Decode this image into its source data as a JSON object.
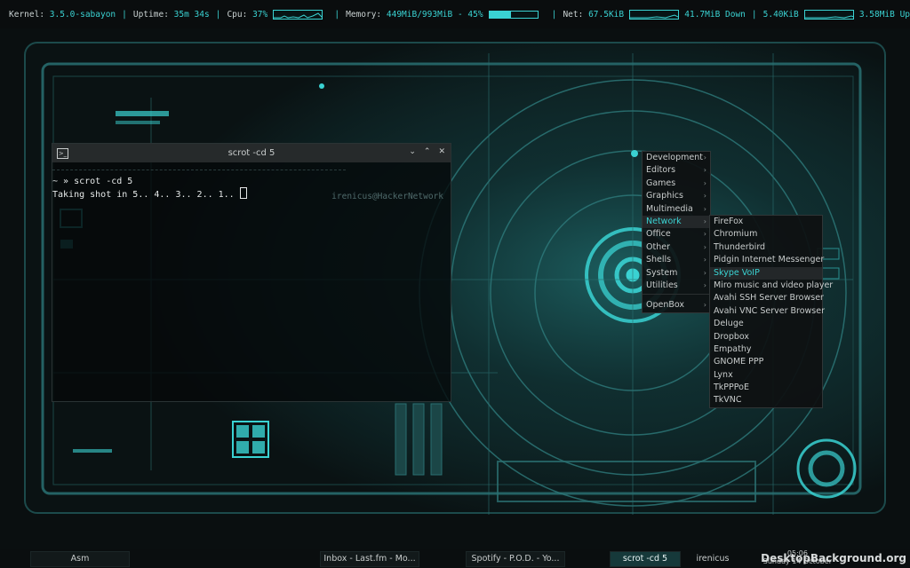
{
  "conky": {
    "kernel_label": "Kernel:",
    "kernel_value": "3.5.0-sabayon",
    "uptime_label": "Uptime:",
    "uptime_value": "35m 34s",
    "cpu_label": "Cpu:",
    "cpu_value": "37%",
    "memory_label": "Memory:",
    "memory_value": "449MiB/993MiB - 45%",
    "memory_fraction": 0.45,
    "net_label": "Net:",
    "net_down_rate": "67.5KiB",
    "net_down_total": "41.7MiB Down",
    "net_up_rate": "5.40KiB",
    "net_up_total": "3.58MiB Up",
    "accent_color": "#3ad2d2"
  },
  "terminal": {
    "title": "scrot -cd 5",
    "title_icon": "terminal-icon",
    "buttons": [
      "chevron-down-icon",
      "chevron-up-icon",
      "close-icon"
    ],
    "prompt": "~ » scrot -cd 5",
    "host": "irenicus@HackerNetwork",
    "output": "Taking shot in 5.. 4.. 3.. 2.. 1.. "
  },
  "menu": {
    "items": [
      {
        "label": "Development",
        "submenu": true
      },
      {
        "label": "Editors",
        "submenu": true
      },
      {
        "label": "Games",
        "submenu": true
      },
      {
        "label": "Graphics",
        "submenu": true
      },
      {
        "label": "Multimedia",
        "submenu": true
      },
      {
        "label": "Network",
        "submenu": true,
        "selected": true
      },
      {
        "label": "Office",
        "submenu": true
      },
      {
        "label": "Other",
        "submenu": true
      },
      {
        "label": "Shells",
        "submenu": true
      },
      {
        "label": "System",
        "submenu": true
      },
      {
        "label": "Utilities",
        "submenu": true
      },
      {
        "label": "OpenBox",
        "submenu": true
      }
    ]
  },
  "network_submenu": {
    "items": [
      {
        "label": "FireFox"
      },
      {
        "label": "Chromium"
      },
      {
        "label": "Thunderbird"
      },
      {
        "label": "Pidgin Internet Messenger"
      },
      {
        "label": "Skype VoIP",
        "selected": true
      },
      {
        "label": "Miro music and video player"
      },
      {
        "label": "Avahi SSH Server Browser"
      },
      {
        "label": "Avahi VNC Server Browser"
      },
      {
        "label": "Deluge"
      },
      {
        "label": "Dropbox"
      },
      {
        "label": "Empathy"
      },
      {
        "label": "GNOME PPP"
      },
      {
        "label": "Lynx"
      },
      {
        "label": "TkPPPoE"
      },
      {
        "label": "TkVNC"
      }
    ]
  },
  "taskbar": {
    "tasks": [
      {
        "label": "Asm",
        "active": false
      },
      {
        "label": "Inbox - Last.fm - Mo...",
        "active": false
      },
      {
        "label": "Spotify - P.O.D. - Yo...",
        "active": false
      },
      {
        "label": "scrot -cd 5",
        "active": true
      },
      {
        "label": "irenicus",
        "active": false
      }
    ],
    "clock_time": "05:06",
    "clock_date": "Sunday 14 October",
    "watermark": "DesktopBackground.org"
  }
}
